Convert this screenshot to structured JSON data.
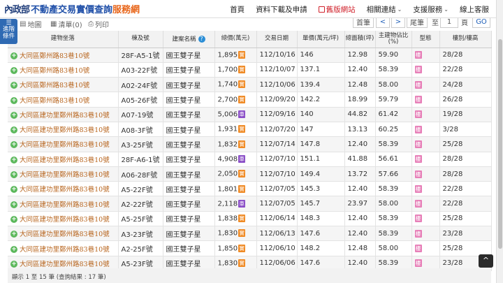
{
  "header": {
    "logo_seal": "內政部",
    "title_main": "不動產交易實價查詢",
    "title_accent": "服務網",
    "nav": [
      {
        "label": "首頁"
      },
      {
        "label": "資料下載及申請"
      },
      {
        "label": "舊版網站"
      },
      {
        "label": "相關連結"
      },
      {
        "label": "支援服務"
      },
      {
        "label": "線上客服"
      }
    ]
  },
  "toolbar": {
    "filter_tab": "進階條件",
    "map_label": "地圖",
    "list_label": "清單(0)",
    "print_label": "列印",
    "first_page": "首筆",
    "prev": "<",
    "next": ">",
    "last_page": "尾筆",
    "goto_label": "至",
    "page_value": "1",
    "page_unit": "頁",
    "go_label": "GO"
  },
  "table": {
    "columns": [
      "建物坐落",
      "棟及號",
      "建案名稱",
      "總價(萬元)",
      "交易日期",
      "單價(萬元/坪)",
      "總面積(坪)",
      "主建物佔比(%)",
      "型態",
      "樓別/樓高"
    ],
    "rows": [
      {
        "addr": "大同區鄭州路83巷10號",
        "unit": "28F-A5-1號",
        "project": "國王雙子星",
        "price": "1,895",
        "badge": "實",
        "date": "112/10/16",
        "unit_price": "146",
        "area": "12.98",
        "ratio": "59.90",
        "type": "樓",
        "floor": "28/28"
      },
      {
        "addr": "大同區鄭州路83巷10號",
        "unit": "A03-22F號",
        "project": "國王雙子星",
        "price": "1,700",
        "badge": "實",
        "date": "112/10/07",
        "unit_price": "137.1",
        "area": "12.40",
        "ratio": "58.39",
        "type": "樓",
        "floor": "22/28"
      },
      {
        "addr": "大同區鄭州路83巷10號",
        "unit": "A02-24F號",
        "project": "國王雙子星",
        "price": "1,740",
        "badge": "實",
        "date": "112/10/06",
        "unit_price": "139.4",
        "area": "12.48",
        "ratio": "58.00",
        "type": "樓",
        "floor": "24/28"
      },
      {
        "addr": "大同區鄭州路83巷10號",
        "unit": "A05-26F號",
        "project": "國王雙子星",
        "price": "2,700",
        "badge": "實",
        "date": "112/09/20",
        "unit_price": "142.2",
        "area": "18.99",
        "ratio": "59.79",
        "type": "樓",
        "floor": "26/28"
      },
      {
        "addr": "大同區建功里鄭州路83巷10號",
        "unit": "A07-19號",
        "project": "國王雙子星",
        "price": "5,006",
        "badge": "車",
        "date": "112/09/16",
        "unit_price": "140",
        "area": "44.82",
        "ratio": "61.42",
        "type": "樓",
        "floor": "19/28"
      },
      {
        "addr": "大同區建功里鄭州路83巷10號",
        "unit": "A08-3F號",
        "project": "國王雙子星",
        "price": "1,931",
        "badge": "實",
        "date": "112/07/20",
        "unit_price": "147",
        "area": "13.13",
        "ratio": "60.25",
        "type": "樓",
        "floor": "3/28"
      },
      {
        "addr": "大同區建功里鄭州路83巷10號",
        "unit": "A3-25F號",
        "project": "國王雙子星",
        "price": "1,832",
        "badge": "實",
        "date": "112/07/14",
        "unit_price": "147.8",
        "area": "12.40",
        "ratio": "58.39",
        "type": "樓",
        "floor": "25/28"
      },
      {
        "addr": "大同區建功里鄭州路83巷10號",
        "unit": "28F-A6-1號",
        "project": "國王雙子星",
        "price": "4,908",
        "badge": "車",
        "date": "112/07/10",
        "unit_price": "151.1",
        "area": "41.88",
        "ratio": "56.61",
        "type": "樓",
        "floor": "28/28"
      },
      {
        "addr": "大同區建功里鄭州路83巷10號",
        "unit": "A06-28F號",
        "project": "國王雙子星",
        "price": "2,050",
        "badge": "實",
        "date": "112/07/10",
        "unit_price": "149.4",
        "area": "13.72",
        "ratio": "57.66",
        "type": "樓",
        "floor": "28/28"
      },
      {
        "addr": "大同區建功里鄭州路83巷10號",
        "unit": "A5-22F號",
        "project": "國王雙子星",
        "price": "1,801",
        "badge": "實",
        "date": "112/07/05",
        "unit_price": "145.3",
        "area": "12.40",
        "ratio": "58.39",
        "type": "樓",
        "floor": "22/28"
      },
      {
        "addr": "大同區建功里鄭州路83巷10號",
        "unit": "A2-22F號",
        "project": "國王雙子星",
        "price": "2,118",
        "badge": "車",
        "date": "112/07/05",
        "unit_price": "145.7",
        "area": "23.97",
        "ratio": "58.00",
        "type": "樓",
        "floor": "22/28"
      },
      {
        "addr": "大同區建功里鄭州路83巷10號",
        "unit": "A5-25F號",
        "project": "國王雙子星",
        "price": "1,838",
        "badge": "實",
        "date": "112/06/14",
        "unit_price": "148.3",
        "area": "12.40",
        "ratio": "58.39",
        "type": "樓",
        "floor": "25/28"
      },
      {
        "addr": "大同區建功里鄭州路83巷10號",
        "unit": "A3-23F號",
        "project": "國王雙子星",
        "price": "1,830",
        "badge": "實",
        "date": "112/06/13",
        "unit_price": "147.6",
        "area": "12.40",
        "ratio": "58.39",
        "type": "樓",
        "floor": "23/28"
      },
      {
        "addr": "大同區建功里鄭州路83巷10號",
        "unit": "A2-25F號",
        "project": "國王雙子星",
        "price": "1,850",
        "badge": "實",
        "date": "112/06/10",
        "unit_price": "148.2",
        "area": "12.48",
        "ratio": "58.00",
        "type": "樓",
        "floor": "25/28"
      },
      {
        "addr": "大同區建功里鄭州路83巷10號",
        "unit": "A5-23F號",
        "project": "國王雙子星",
        "price": "1,830",
        "badge": "實",
        "date": "112/06/06",
        "unit_price": "147.6",
        "area": "12.40",
        "ratio": "58.39",
        "type": "樓",
        "floor": "23/28"
      }
    ]
  },
  "footer": {
    "summary": "顯示 1 至 15 筆 (查詢結果 : 17 筆)"
  },
  "colors": {
    "brand_blue": "#1f4fa8",
    "brand_orange": "#e8671c",
    "address_orange": "#b8651e",
    "badge_real": "#f08a24",
    "badge_car": "#8b4fc7",
    "type_pink": "#e77fb8"
  },
  "icons": {
    "plus": "+",
    "help": "?",
    "totop": "^"
  }
}
